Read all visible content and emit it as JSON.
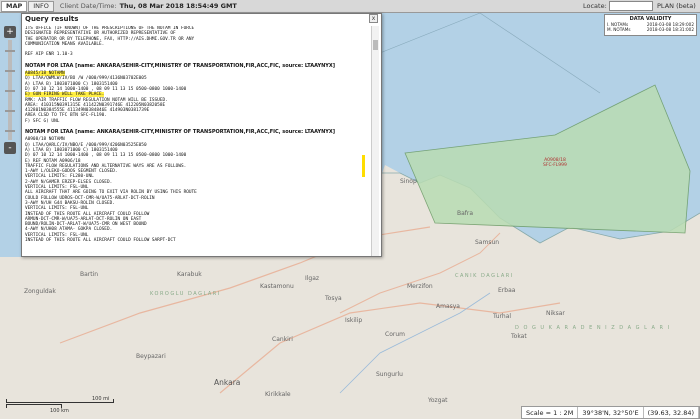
{
  "topbar": {
    "tabs": [
      "MAP",
      "INFO"
    ],
    "clock_label": "Client Date/Time:",
    "clock_value": "Thu, 08 Mar 2018 18:54:49 GMT",
    "locate_label": "Locate:",
    "plan_label": "PLAN (beta)"
  },
  "validity": {
    "title": "DATA VALIDITY",
    "rows": [
      {
        "label": "I. NOTAMs",
        "value": "2018-03-08 18:29:002"
      },
      {
        "label": "M. NOTAMs",
        "value": "2018-03-08 18:31:002"
      }
    ]
  },
  "query": {
    "title": "Query results",
    "close": "x",
    "lines_top": [
      "ITS OFFICE (IF KNOWN) OF THE PRESCRIPTIONS OF THE NOTAM IN FORCE",
      "DESIGNATED REPRESENTATIVE OR AUTHORIZED REPRESENTATIVE OF",
      "THE OPERATOR OR BY TELEPHONE, FAX, HTTP://AIS.DHMI.GOV.TR OR ANY",
      "COMMUNICATION MEANS AVAILABLE.",
      "",
      "REF AIP ENR 1.10-3"
    ],
    "header1": "NOTAM FOR LTAA [name: ANKARA/SEHIR-CITY,MINISTRY OF TRANSPORTATION,FIR,ACC,FIC, source: LTAAYNYX]",
    "notam1_id": "A0845/18 NOTAMN",
    "notam1": [
      "Q) LTAA/QWMLW/IV/BO /W /000/999/4136N03702E005",
      "A) LTAA B) 1803071000 C) 1803151400",
      "D) 07 10 12 14 1000-1400 , 08 09 11 13 15 0500-0800 1000-1400"
    ],
    "notam1_hl": "E) GUN FIRING WILL TAKE PLACE.",
    "notam1_rest": [
      "RMK: AIR TRAFFIC FLOW REGULATION NOTAM WILL BE ISSUED.",
      "AREA: 410315N0391315E 411422N0391746E 412205N0382058E",
      "412801N0384555E 411349N0384846E 414903N0381739E",
      "AREA CLSD TO TFC BTN SFC-FL190.",
      "F) SFC G) UNL"
    ],
    "header2": "NOTAM FOR LTAA [name: ANKARA/SEHIR-CITY,MINISTRY OF TRANSPORTATION,FIR,ACC,FIC, source: LTAAYNYX]",
    "notam2": [
      "A0908/18 NOTAMN",
      "Q) LTAA/QARLC/IV/NBO/E /000/999/4206N03525E050",
      "A) LTAA B) 1803071000 C) 1803151400",
      "D) 07 10 12 14 1000-1400 , 08 09 11 13 15 0500-0800 1000-1400",
      "E) REF NOTAM A0906/18",
      "TRAFFIC FLOW REGULATIONS AND ALTERNATIVE WAYS ARE AS FOLLOWS.",
      "1-AWY L/OLEKO-GODOS SEGMENT CLOSED.",
      "VERTICAL LIMITS: FL280-UNL",
      "2-AWY N/GAMER ERZEP-ELSES CLOSED.",
      "VERTICAL LIMITS: FSL-UNL",
      "ALL AIRCRAFT THAT ARE GOING TO EXIT VIA ROLIN BY USING THIS ROUTE",
      "COULD FOLLOW UDROS-DCT-CMR-W/UA75-ARLAT-DCT-ROLIN",
      "3-AWY N/UH G44 BAKSU-ROLIN CLOSED.",
      "VERTICAL LIMITS: FSL-UNL",
      "INSTEAD OF THIS ROUTE ALL AIRCRAFT COULD FOLLOW",
      "ARMUN-DCT-CMR-W/UA75-ARLAT-DCT-ROLIN ON EAST",
      "BOUND/ROLIN-DCT-ARLAT-W/UA75-CMR ON WEST BOUND",
      "4-AWY N/UH08 ATAMA- GOKPA CLOSED.",
      "VERTICAL LIMITS: FSL-UNL",
      "INSTEAD OF THIS ROUTE ALL AIRCRAFT COULD FOLLOW SARPT-DCT"
    ]
  },
  "map": {
    "area_label1": "A0908/18",
    "area_label2": "SFC-FL999",
    "places": [
      "Sinop",
      "Bafra",
      "Samsun",
      "Ankara",
      "Kastamonu",
      "Cankiri",
      "Kirikkale",
      "Tosya",
      "Merzifon",
      "Amasya",
      "Corum",
      "Karabuk",
      "Beypazari",
      "Iskilip",
      "Sungurlu",
      "Tokat",
      "Turhal",
      "Niksar",
      "Erbaa",
      "Yozgat",
      "Bartin",
      "Zonguldak",
      "Ilgaz"
    ],
    "mountains": [
      "KOROGLU DAGLARI",
      "CANIK DAGLARI",
      "D O G U K A R A D E N I Z   D A G L A R I"
    ]
  },
  "zoom": {
    "plus": "+",
    "minus": "-"
  },
  "scale": {
    "top_label": "100 mi",
    "bottom_label": "100 km"
  },
  "status": {
    "scale_text": "Scale = 1 : 2M",
    "coords_dms": "39°38'N, 32°50'E",
    "coords_dec": "(39.63, 32.84)"
  }
}
